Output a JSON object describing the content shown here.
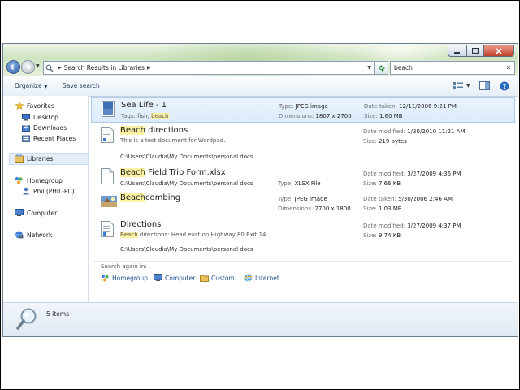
{
  "window": {
    "address": "Search Results in Libraries",
    "search_value": "beach"
  },
  "toolbar": {
    "organize": "Organize",
    "save_search": "Save search"
  },
  "nav": {
    "favorites": "Favorites",
    "desktop": "Desktop",
    "downloads": "Downloads",
    "recent_places": "Recent Places",
    "libraries": "Libraries",
    "homegroup": "Homegroup",
    "phil": "Phil (PHIL-PC)",
    "computer": "Computer",
    "network": "Network"
  },
  "results": [
    {
      "name_hl": "",
      "name_rest": "Sea Life - 1",
      "sub_label": "Tags: ",
      "sub_plain": "fish; ",
      "sub_hl": "beach",
      "path": "",
      "c2_label": "Type: ",
      "c2_value": "JPEG image",
      "c2b_label": "Dimensions: ",
      "c2b_value": "1807 x 2700",
      "c3_label": "Date taken: ",
      "c3_value": "12/11/2006 9:21 PM",
      "c3b_label": "Size: ",
      "c3b_value": "1.60 MB"
    },
    {
      "name_hl": "Beach",
      "name_rest": " directions",
      "sub_plain": "This is a test document for Wordpad.",
      "path": "C:\\Users\\Claudia\\My Documents\\personal docs",
      "c3_label": "Date modified: ",
      "c3_value": "1/30/2010 11:21 AM",
      "c3b_label": "Size: ",
      "c3b_value": "219 bytes"
    },
    {
      "name_hl": "Beach",
      "name_rest": " Field Trip Form.xlsx",
      "path": "C:\\Users\\Claudia\\My Documents\\personal docs",
      "c2_label": "Type: ",
      "c2_value": "XLSX File",
      "c3_label": "Date modified: ",
      "c3_value": "3/27/2009 4:36 PM",
      "c3b_label": "Size: ",
      "c3b_value": "7.66 KB"
    },
    {
      "name_hl": "Beach",
      "name_rest": "combing",
      "c2_label": "Type: ",
      "c2_value": "JPEG image",
      "c2b_label": "Dimensions: ",
      "c2b_value": "2700 x 1800",
      "c3_label": "Date taken: ",
      "c3_value": "5/30/2006 2:46 AM",
      "c3b_label": "Size: ",
      "c3b_value": "1.03 MB"
    },
    {
      "name_hl": "",
      "name_rest": "Directions",
      "sub_hl": "Beach",
      "sub_plain": " directions: Head east on Highway 80 Exit 14",
      "path": "C:\\Users\\Claudia\\My Documents\\personal docs",
      "c3_label": "Date modified: ",
      "c3_value": "3/27/2009 4:37 PM",
      "c3b_label": "Size: ",
      "c3b_value": "9.74 KB"
    }
  ],
  "search_again": {
    "label": "Search again in:",
    "homegroup": "Homegroup",
    "computer": "Computer",
    "custom": "Custom...",
    "internet": "Internet"
  },
  "status": {
    "count": "5 items"
  }
}
